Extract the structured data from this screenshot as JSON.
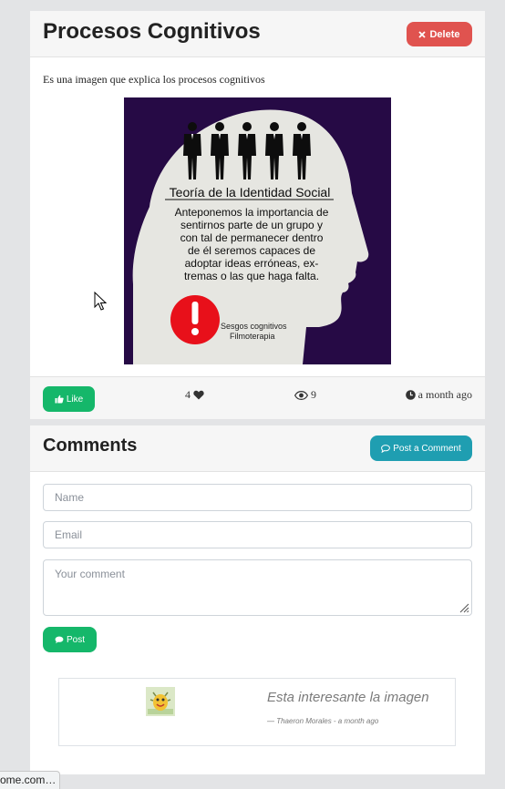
{
  "post": {
    "title": "Procesos Cognitivos",
    "delete_label": "Delete",
    "description": "Es una imagen que explica los procesos cognitivos",
    "image": {
      "heading": "Teoría de la Identidad Social",
      "body_lines": [
        "Anteponemos la importancia de",
        "sentirnos parte de un grupo y",
        "con tal de permanecer dentro",
        "de él seremos capaces de",
        "adoptar ideas erróneas, ex-",
        "tremas o las que haga falta."
      ],
      "badge_line1": "Sesgos cognitivos",
      "badge_line2": "Filmoterapia",
      "background": "#260a45",
      "head_color": "#e6e6e1",
      "alert_color": "#e8101a"
    },
    "like_label": "Like",
    "likes_count": "4",
    "views_count": "9",
    "time_ago": "a month ago"
  },
  "comments": {
    "title": "Comments",
    "post_comment_label": "Post a Comment",
    "name_placeholder": "Name",
    "email_placeholder": "Email",
    "comment_placeholder": "Your comment",
    "post_label": "Post",
    "items": [
      {
        "text": "Esta interesante la imagen",
        "meta": "—  Thaeron Morales - a month ago"
      }
    ]
  },
  "status_bar": {
    "text": "ome.com…"
  },
  "colors": {
    "delete": "#e0534f",
    "success": "#15b76a",
    "info": "#1f9eb1"
  },
  "icons": [
    "close-icon",
    "thumbs-up-icon",
    "heart-icon",
    "eye-icon",
    "clock-icon",
    "comment-icon",
    "resize-grip-icon",
    "cursor-icon"
  ]
}
